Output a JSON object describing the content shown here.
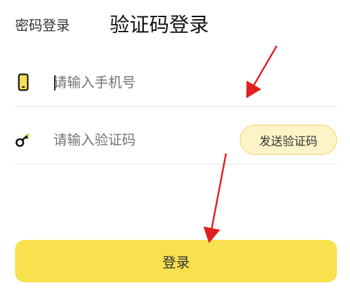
{
  "tabs": {
    "password_login": "密码登录",
    "code_login": "验证码登录"
  },
  "phone": {
    "placeholder": "请输入手机号",
    "icon": "phone-icon"
  },
  "code": {
    "placeholder": "请输入验证码",
    "icon": "key-icon",
    "send_label": "发送验证码"
  },
  "login_button": "登录",
  "colors": {
    "accent": "#f8e14e",
    "send_bg": "#fdf3c8",
    "arrow": "#e02020"
  }
}
